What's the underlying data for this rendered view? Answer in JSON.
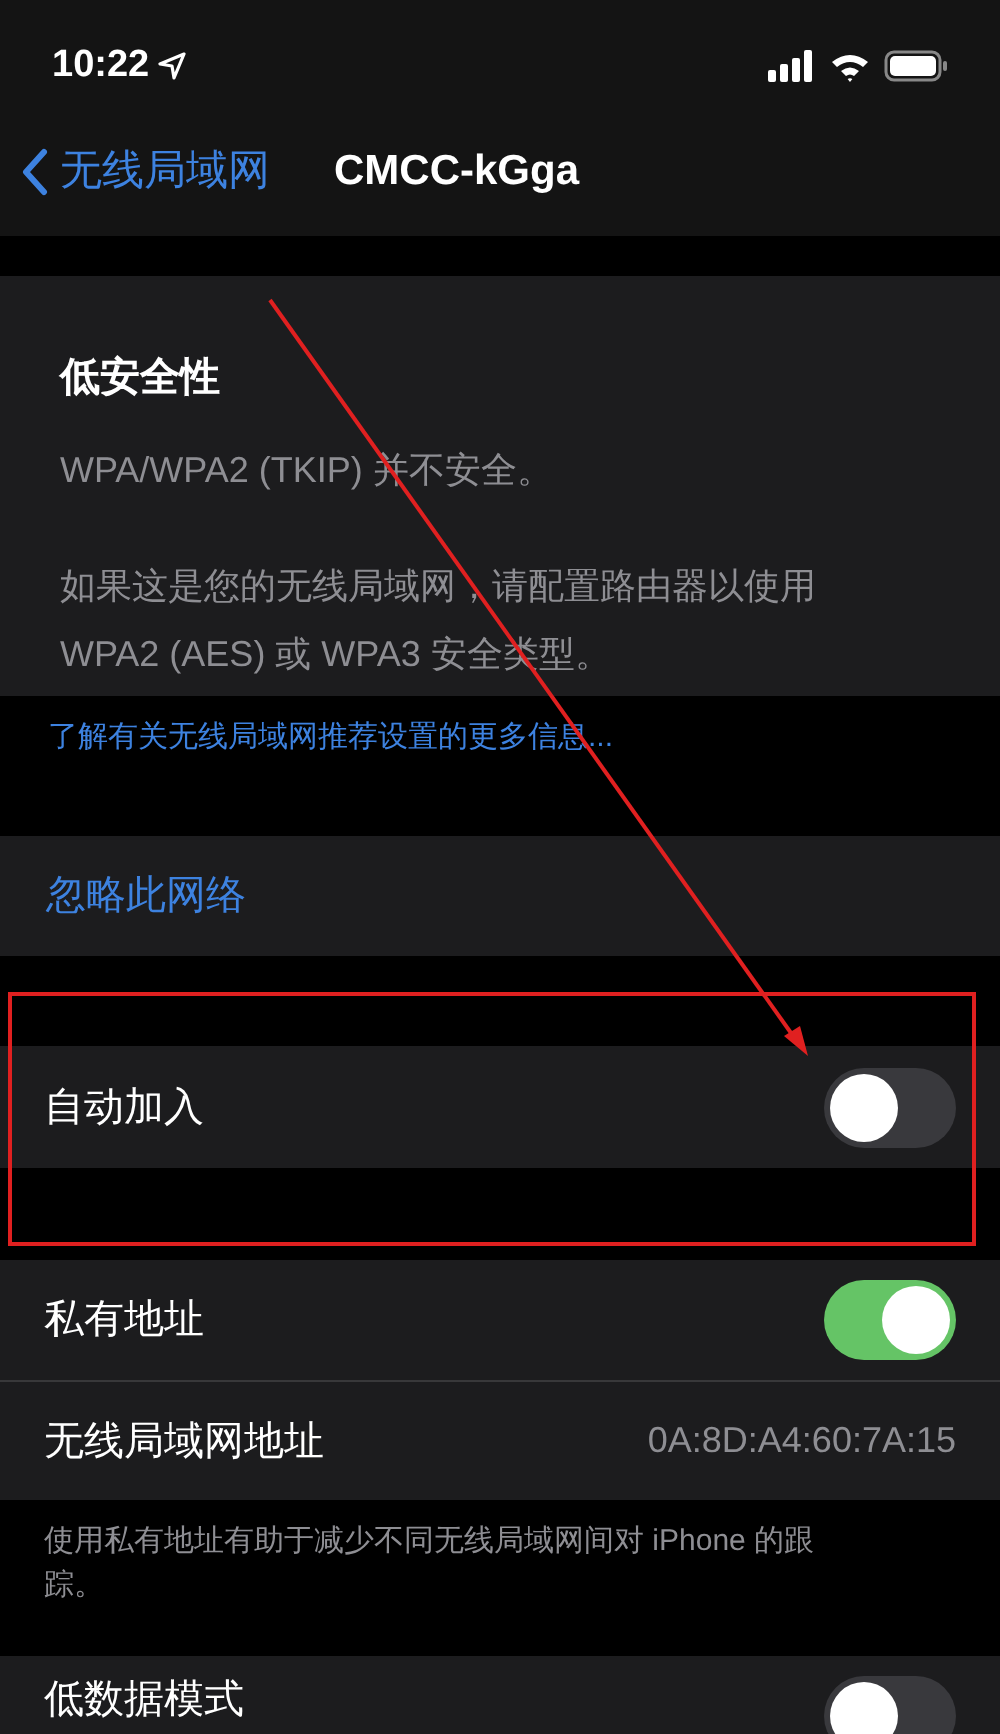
{
  "status_bar": {
    "time": "10:22"
  },
  "nav": {
    "back_label": "无线局域网",
    "title": "CMCC-kGga"
  },
  "security": {
    "title": "低安全性",
    "lines": [
      "WPA/WPA2 (TKIP) 并不安全。",
      "如果这是您的无线局域网，请配置路由器以使用 WPA2 (AES) 或 WPA3 安全类型。"
    ]
  },
  "info_link": "了解有关无线局域网推荐设置的更多信息...",
  "forget": "忽略此网络",
  "auto_join": {
    "label": "自动加入",
    "on": false
  },
  "private_address": {
    "label": "私有地址",
    "on": true
  },
  "wifi_address": {
    "label": "无线局域网地址",
    "value": "0A:8D:A4:60:7A:15"
  },
  "private_note": "使用私有地址有助于减少不同无线局域网间对 iPhone 的跟踪。",
  "low_data": {
    "label": "低数据模式",
    "on": false
  }
}
